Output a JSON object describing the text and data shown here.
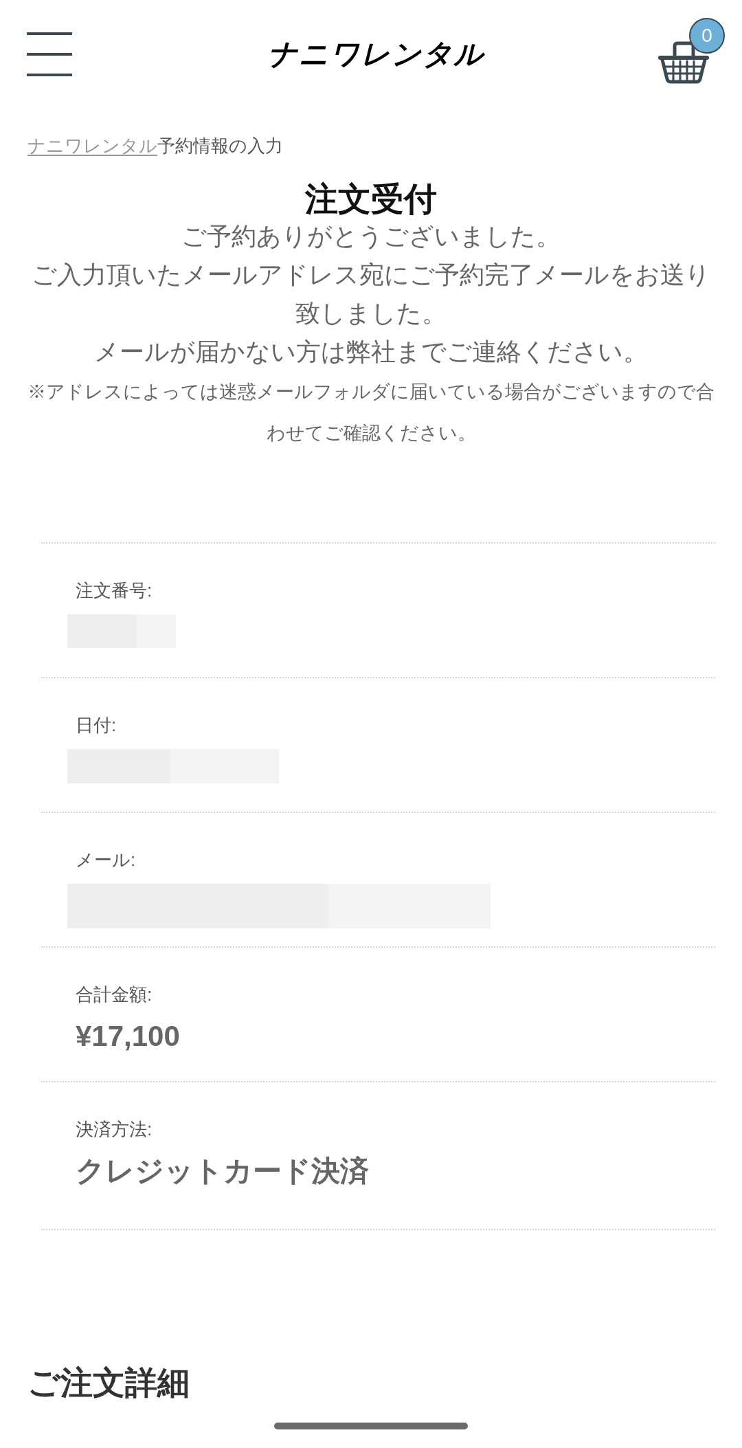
{
  "header": {
    "logo": "ナニワレンタル",
    "cart": {
      "count": "0"
    }
  },
  "breadcrumb": [
    {
      "label": "ナニワレンタル",
      "kind": "link"
    },
    {
      "label": "予約情報の入力",
      "kind": "current"
    }
  ],
  "title": "注文受付",
  "message": [
    "ご予約ありがとうございました。",
    "ご入力頂いたメールアドレス宛にご予約完了メールをお送り致しました。",
    "メールが届かない方は弊社までご連絡ください。"
  ],
  "note": "※アドレスによっては迷惑メールフォルダに届いている場合がございますので合わせてご確認ください。",
  "order_info": [
    {
      "label": "注文番号:",
      "kind": "redacted"
    },
    {
      "label": "日付:",
      "kind": "redacted"
    },
    {
      "label": "メール:",
      "kind": "redacted"
    },
    {
      "label": "合計金額:",
      "kind": "text",
      "value": "¥17,100"
    },
    {
      "label": "決済方法:",
      "kind": "text",
      "value": "クレジットカード決済"
    }
  ],
  "section_heading": "ご注文詳細"
}
